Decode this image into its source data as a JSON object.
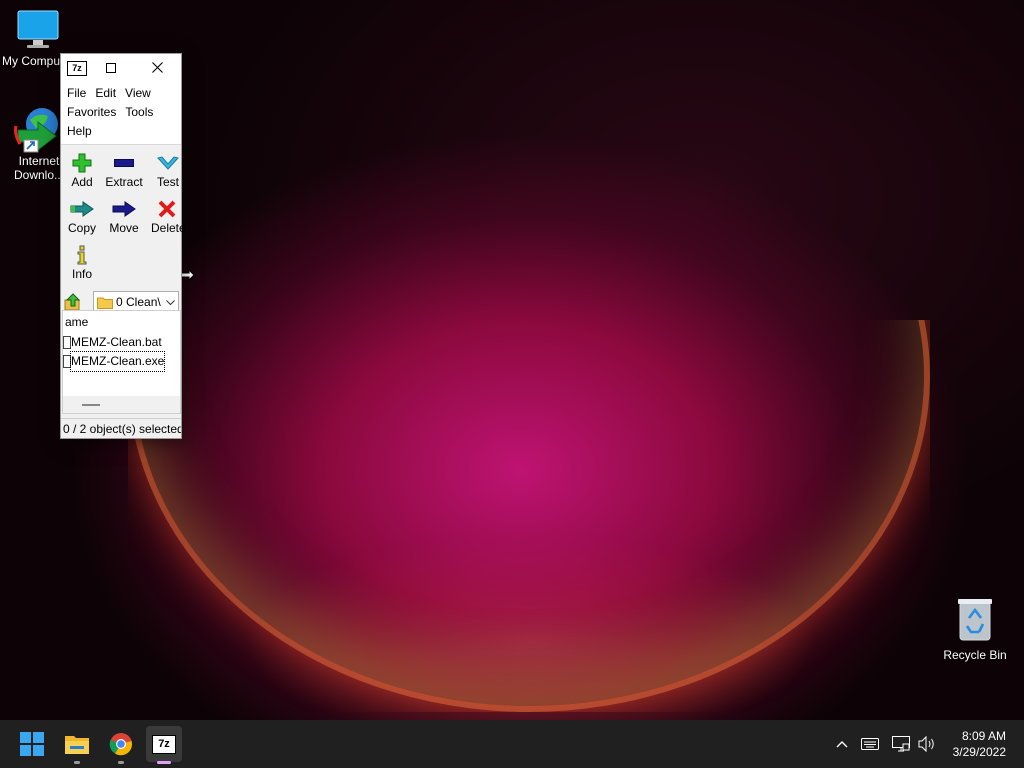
{
  "desktop": {
    "icons": [
      {
        "label": "My Compu"
      },
      {
        "label_line1": "Internet",
        "label_line2": "Downlo..."
      },
      {
        "label": "Recycle Bin"
      }
    ]
  },
  "window": {
    "app_icon": "7z",
    "menu": [
      "File",
      "Edit",
      "View",
      "Favorites",
      "Tools",
      "Help"
    ],
    "toolbar": [
      "Add",
      "Extract",
      "Test",
      "Copy",
      "Move",
      "Delete",
      "Info"
    ],
    "path": "0 Clean\\",
    "list_header": "ame",
    "files": [
      "MEMZ-Clean.bat",
      "MEMZ-Clean.exe"
    ],
    "status": "0 / 2 object(s) selected"
  },
  "taskbar": {
    "apps": [
      "start-icon",
      "file-explorer-icon",
      "chrome-icon",
      "7zip-icon"
    ],
    "time": "8:09 AM",
    "date": "3/29/2022"
  },
  "colors": {
    "taskbar": "#202020",
    "add_green": "#2fbf2f",
    "delete_red": "#e11a1a",
    "arrow_navy": "#1a1a8c",
    "test_cyan": "#34b8e0"
  }
}
